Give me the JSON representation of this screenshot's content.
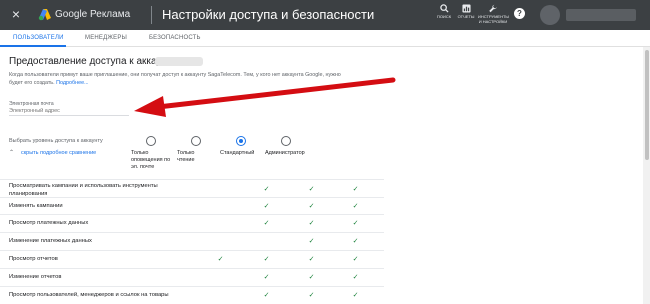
{
  "header": {
    "close_icon": "×",
    "brand": "Google Реклама",
    "title": "Настройки доступа и безопасности",
    "tools": [
      {
        "label": "ПОИСК",
        "icon": "search-icon"
      },
      {
        "label": "ОТЧЕТЫ",
        "icon": "reports-icon"
      },
      {
        "label": "ИНСТРУМЕНТЫ\nИ НАСТРОЙКИ",
        "icon": "wrench-icon"
      }
    ],
    "help": "?"
  },
  "tabs": [
    {
      "label": "ПОЛЬЗОВАТЕЛИ",
      "active": true
    },
    {
      "label": "МЕНЕДЖЕРЫ",
      "active": false
    },
    {
      "label": "БЕЗОПАСНОСТЬ",
      "active": false
    }
  ],
  "section": {
    "title": "Предоставление доступа к аккаунту",
    "description": "Когда пользователи примут ваше приглашение, они получат доступ к аккаунту SagaTelecom. Тем, у кого нет аккаунта Google, нужно будет его создать.",
    "more_link": "Подробнее..."
  },
  "email": {
    "label": "Электронная почта",
    "placeholder": "Электронный адрес"
  },
  "access": {
    "label": "Выбрать уровень доступа к аккаунту",
    "toggle_link": "скрыть подробное сравнение",
    "levels": [
      {
        "label": "Только оповещения по эл. почте",
        "selected": false
      },
      {
        "label": "Только чтение",
        "selected": false
      },
      {
        "label": "Стандартный",
        "selected": true
      },
      {
        "label": "Администратор",
        "selected": false
      }
    ]
  },
  "permissions": [
    {
      "label": "Просматривать кампании и использовать инструменты планирования",
      "checks": [
        false,
        false,
        true,
        true,
        true
      ]
    },
    {
      "label": "Изменять кампании",
      "checks": [
        false,
        false,
        true,
        true,
        true
      ]
    },
    {
      "label": "Просмотр платежных данных",
      "checks": [
        false,
        false,
        true,
        true,
        true
      ]
    },
    {
      "label": "Изменение платежных данных",
      "checks": [
        false,
        false,
        false,
        true,
        true
      ]
    },
    {
      "label": "Просмотр отчетов",
      "checks": [
        false,
        true,
        true,
        true,
        true
      ]
    },
    {
      "label": "Изменение отчетов",
      "checks": [
        false,
        false,
        true,
        true,
        true
      ]
    },
    {
      "label": "Просмотр пользователей, менеджеров и ссылок на товары",
      "checks": [
        false,
        false,
        true,
        true,
        true
      ]
    }
  ],
  "colors": {
    "header_bg": "#3c4043",
    "accent": "#1a73e8",
    "check": "#188038",
    "arrow": "#d40d12"
  }
}
